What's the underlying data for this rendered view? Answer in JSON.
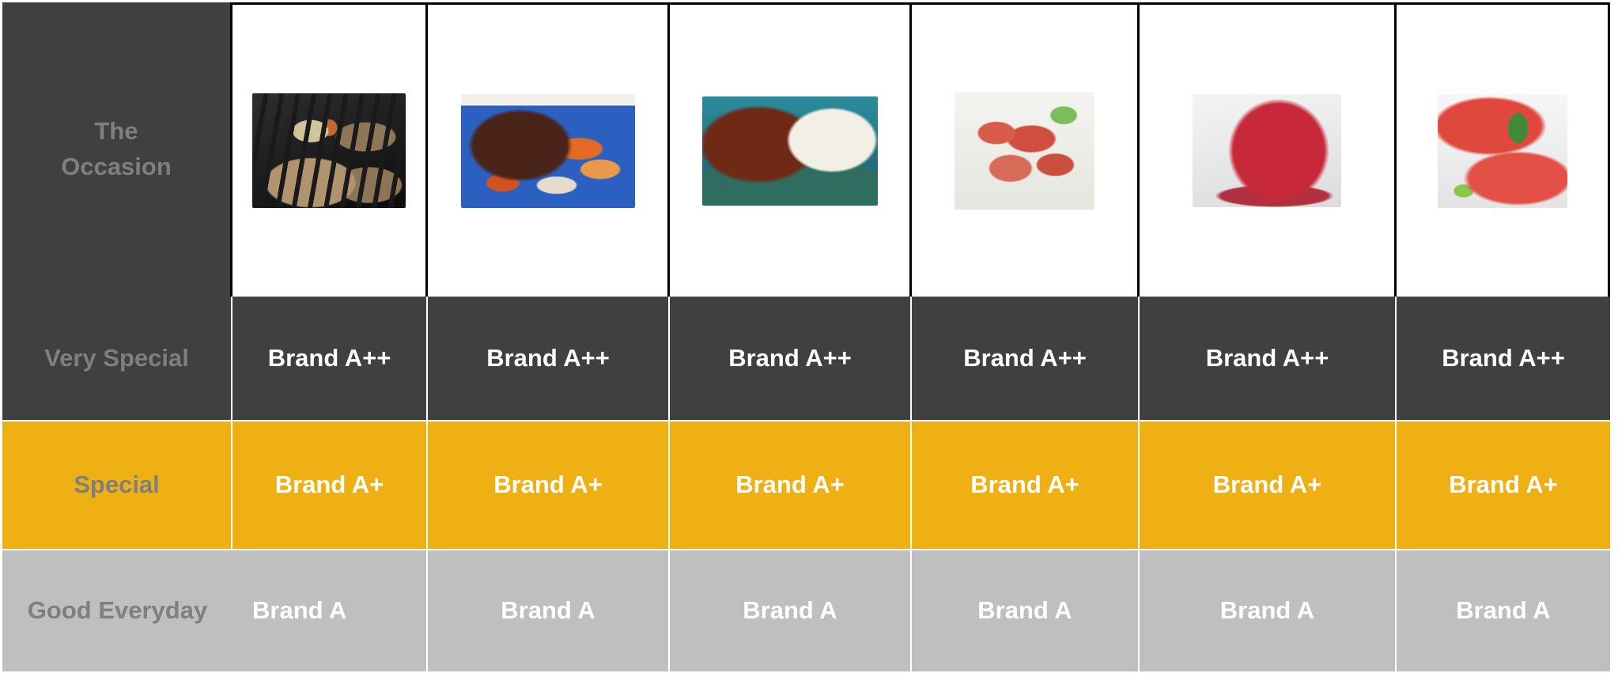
{
  "colors": {
    "very_special_bg": "#404040",
    "special_bg": "#efb014",
    "good_everyday_bg": "#bfbfbf",
    "label_text": "#7f7f7f",
    "value_text": "#ffffff"
  },
  "header": {
    "label_line1": "The",
    "label_line2": "Occasion",
    "images": [
      "grilled-steaks-image",
      "roast-beef-vegetables-image",
      "beef-stew-rice-image",
      "sausages-image",
      "beef-tartare-image",
      "salmon-fillet-image"
    ]
  },
  "rows": [
    {
      "label": "Very Special",
      "values": [
        "Brand A++",
        "Brand A++",
        "Brand A++",
        "Brand A++",
        "Brand A++",
        "Brand A++"
      ]
    },
    {
      "label": "Special",
      "values": [
        "Brand A+",
        "Brand A+",
        "Brand A+",
        "Brand A+",
        "Brand A+",
        "Brand A+"
      ]
    },
    {
      "label": "Good Everyday",
      "values": [
        "Brand A",
        "Brand A",
        "Brand A",
        "Brand A",
        "Brand A",
        "Brand A"
      ]
    }
  ]
}
